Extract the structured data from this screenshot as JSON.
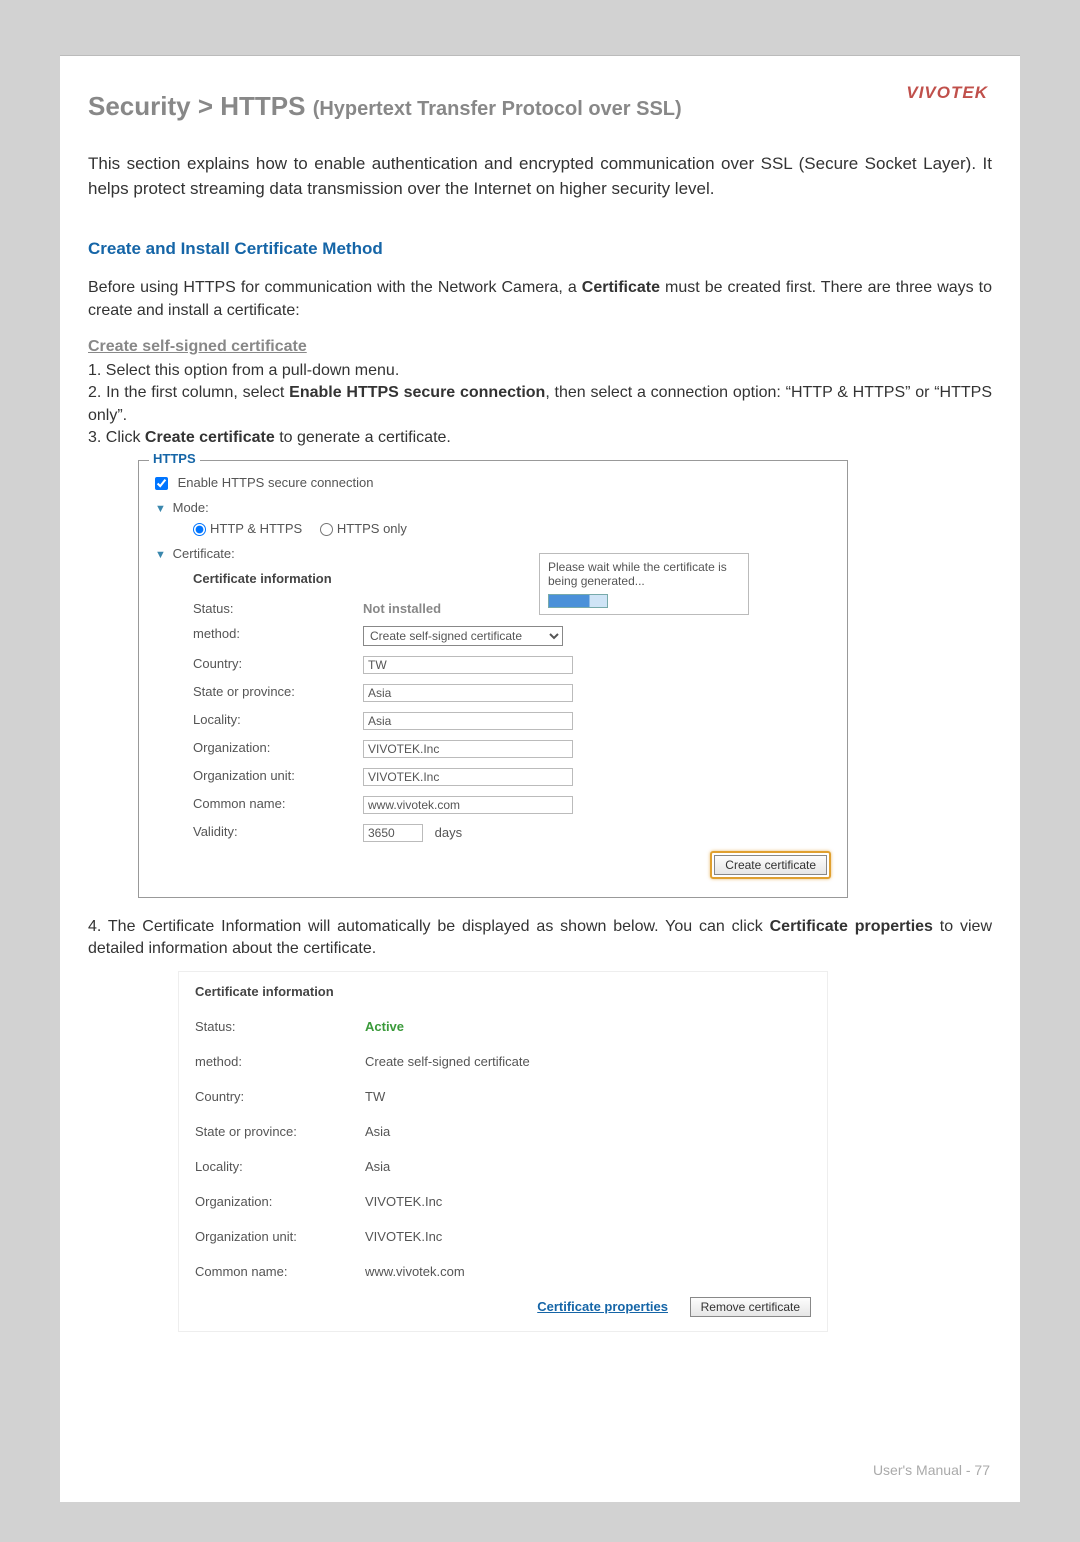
{
  "brand": "VIVOTEK",
  "page_title_main": "Security  >  HTTPS ",
  "page_title_sub": "(Hypertext Transfer Protocol over SSL)",
  "intro": "This section explains how to enable authentication and encrypted communication over SSL (Secure Socket Layer). It helps protect streaming data transmission over the Internet on higher security level.",
  "subhead": "Create and Install Certificate Method",
  "before_para_1": "Before using HTTPS for communication with the Network Camera, a ",
  "before_para_bold": "Certificate",
  "before_para_2": " must be created first. There are three ways to create and install a certificate:",
  "subsub": "Create self-signed certificate",
  "step1": "1. Select this option from a pull-down menu.",
  "step2a": "2. In the first column, select ",
  "step2b": "Enable HTTPS secure connection",
  "step2c": ", then select a connection option: “HTTP & HTTPS” or “HTTPS only”.",
  "step3a": "3. Click ",
  "step3b": "Create certificate",
  "step3c": " to generate a certificate.",
  "panel1": {
    "legend": "HTTPS",
    "enable_label": "Enable HTTPS secure connection",
    "enable_checked": true,
    "mode_label": "Mode:",
    "mode_opt1": "HTTP & HTTPS",
    "mode_opt2": "HTTPS only",
    "cert_section": "Certificate:",
    "cert_header": "Certificate information",
    "wait_msg": "Please wait while the certificate is being generated...",
    "rows": {
      "status_label": "Status:",
      "status_value": "Not installed",
      "method_label": "method:",
      "method_value": "Create self-signed certificate",
      "country_label": "Country:",
      "country_value": "TW",
      "state_label": "State or province:",
      "state_value": "Asia",
      "locality_label": "Locality:",
      "locality_value": "Asia",
      "org_label": "Organization:",
      "org_value": "VIVOTEK.Inc",
      "orgunit_label": "Organization unit:",
      "orgunit_value": "VIVOTEK.Inc",
      "cn_label": "Common name:",
      "cn_value": "www.vivotek.com",
      "validity_label": "Validity:",
      "validity_value": "3650",
      "validity_unit": "days"
    },
    "create_btn": "Create certificate"
  },
  "step4a": "4. The Certificate Information will automatically be displayed as shown below. You can click ",
  "step4b": "Certificate properties",
  "step4c": " to view detailed information about the certificate.",
  "panel2": {
    "cert_header": "Certificate information",
    "rows": {
      "status_label": "Status:",
      "status_value": "Active",
      "method_label": "method:",
      "method_value": "Create self-signed certificate",
      "country_label": "Country:",
      "country_value": "TW",
      "state_label": "State or province:",
      "state_value": "Asia",
      "locality_label": "Locality:",
      "locality_value": "Asia",
      "org_label": "Organization:",
      "org_value": "VIVOTEK.Inc",
      "orgunit_label": "Organization unit:",
      "orgunit_value": "VIVOTEK.Inc",
      "cn_label": "Common name:",
      "cn_value": "www.vivotek.com"
    },
    "cert_props_link": "Certificate properties",
    "remove_btn": "Remove certificate"
  },
  "footer_prefix": "User's Manual - ",
  "footer_page": "77"
}
